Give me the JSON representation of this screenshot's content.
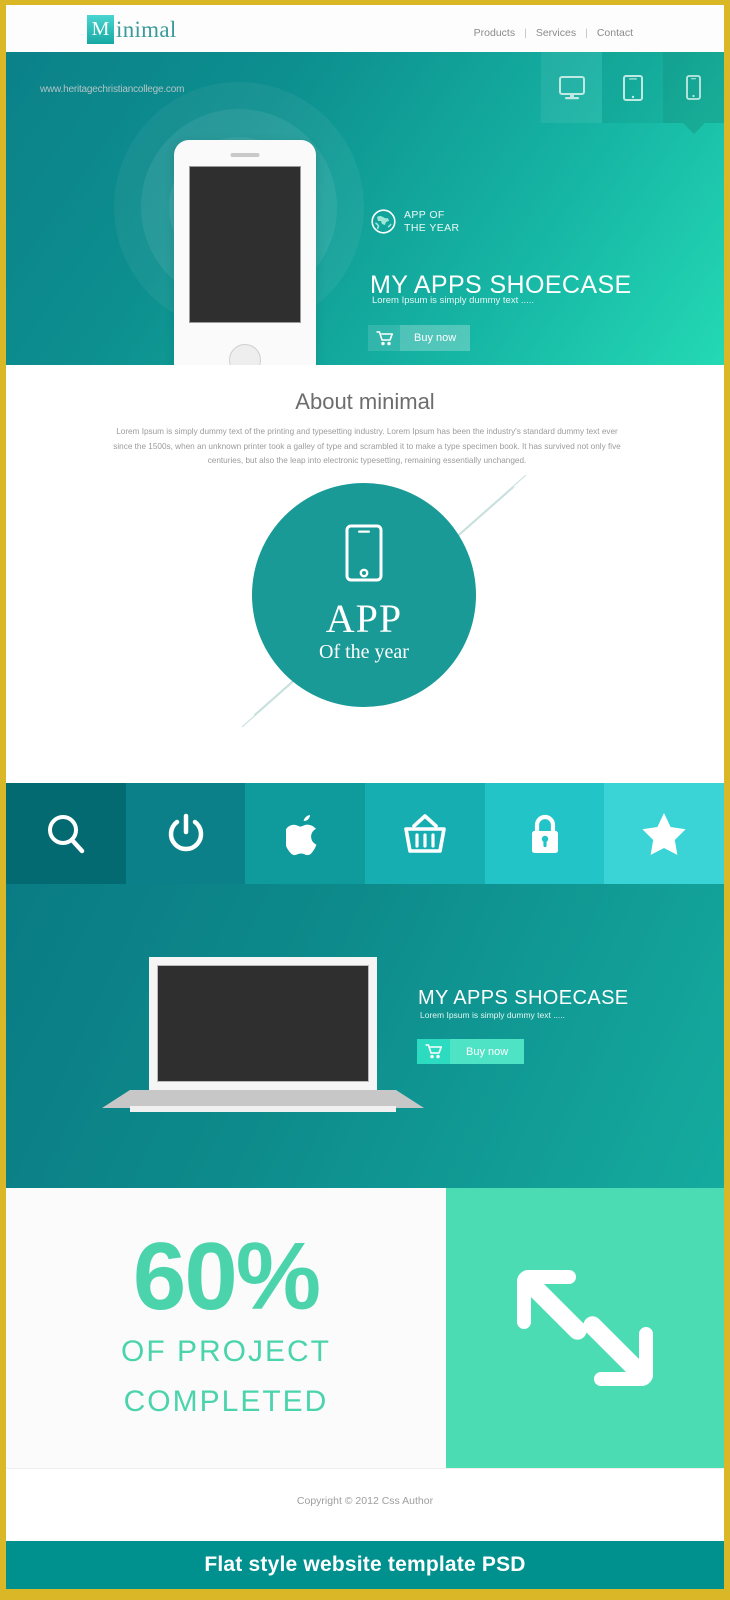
{
  "theme": {
    "frame_border": "#d9b726",
    "teal_dark": "#0a7b84",
    "teal_mid": "#199a96",
    "teal_light": "#24d9b4",
    "accent_green": "#4bd4ab",
    "banner_teal": "#00918f"
  },
  "header": {
    "logo_mark": "M",
    "logo_text": "inimal",
    "nav": [
      {
        "label": "Products"
      },
      {
        "label": "Services"
      },
      {
        "label": "Contact"
      }
    ],
    "separator": "|"
  },
  "hero": {
    "device_tabs": [
      {
        "icon": "desktop-icon",
        "active": false
      },
      {
        "icon": "tablet-icon",
        "active": false
      },
      {
        "icon": "mobile-icon",
        "active": true
      }
    ],
    "award_icon": "globe-icon",
    "award_line1": "APP OF",
    "award_line2": "THE YEAR",
    "title": "MY APPS SHOECASE",
    "subtitle": "Lorem Ipsum is simply dummy text .....",
    "buy_icon": "cart-icon",
    "buy_label": "Buy now"
  },
  "about": {
    "title": "About minimal",
    "body": "Lorem Ipsum is simply dummy text of the printing and typesetting industry. Lorem Ipsum has been the industry's standard dummy text ever since the 1500s, when an unknown printer took a galley of type and scrambled it to make a type specimen book. It has survived not only five centuries, but also the leap into electronic typesetting, remaining essentially unchanged.",
    "badge_icon": "mobile-icon",
    "badge_title": "APP",
    "badge_subtitle": "Of the year"
  },
  "icon_bar": {
    "items": [
      {
        "icon": "search-icon",
        "color": "#046a72"
      },
      {
        "icon": "power-icon",
        "color": "#0b8089"
      },
      {
        "icon": "apple-icon",
        "color": "#0f9a9c"
      },
      {
        "icon": "basket-icon",
        "color": "#16aeb0"
      },
      {
        "icon": "lock-icon",
        "color": "#22c4c8"
      },
      {
        "icon": "star-icon",
        "color": "#3ad3d6"
      }
    ]
  },
  "laptop_section": {
    "title": "MY APPS SHOECASE",
    "subtitle": "Lorem Ipsum is simply dummy text .....",
    "buy_icon": "cart-icon",
    "buy_label": "Buy now"
  },
  "stats": {
    "percent": "60%",
    "line1": "OF PROJECT",
    "line2": "COMPLETED",
    "panel_icon": "resize-arrows-icon"
  },
  "footer": {
    "copyright": "Copyright © 2012 Css Author",
    "watermark": "www.heritagechristiancollege.com",
    "banner": "Flat style  website template PSD"
  }
}
